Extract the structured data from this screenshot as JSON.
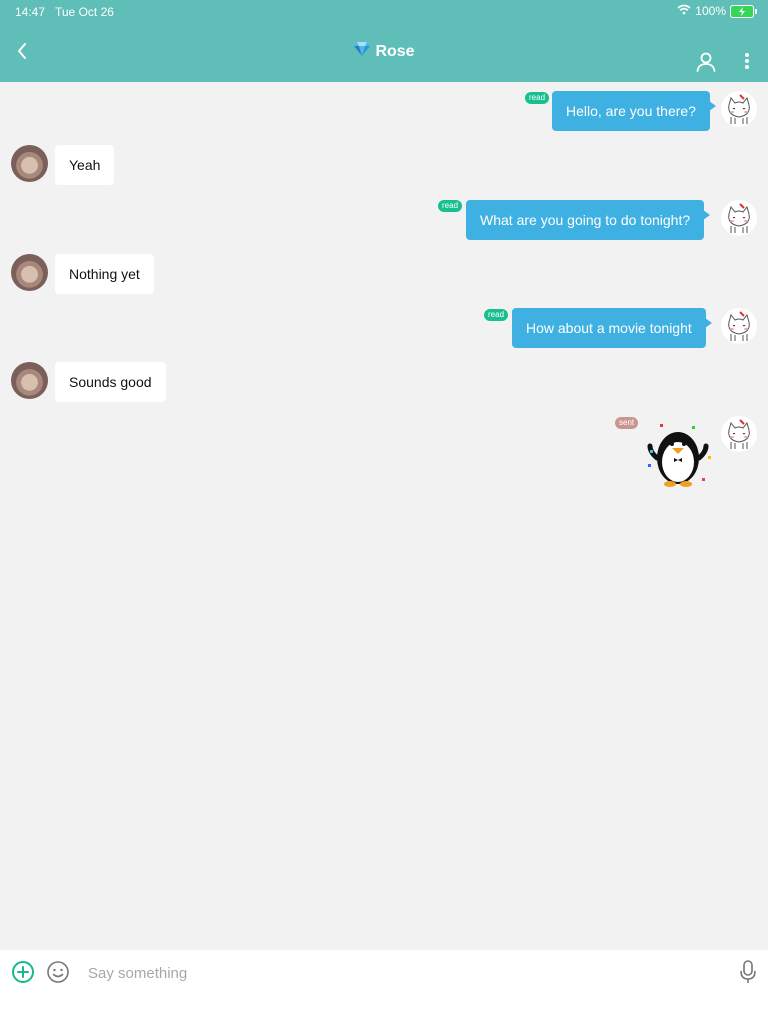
{
  "status_bar": {
    "time": "14:47",
    "date": "Tue Oct 26",
    "battery": "100%"
  },
  "header": {
    "title": "Rose",
    "title_icon": "diamond-icon",
    "back_icon": "chevron-left-icon",
    "profile_icon": "person-icon",
    "more_icon": "more-vertical-icon"
  },
  "messages": [
    {
      "side": "right",
      "text": "Hello, are you there?",
      "status": "read"
    },
    {
      "side": "left",
      "text": "Yeah"
    },
    {
      "side": "right",
      "text": "What are you going to do tonight?",
      "status": "read"
    },
    {
      "side": "left",
      "text": "Nothing yet"
    },
    {
      "side": "right",
      "text": "How about a movie tonight",
      "status": "read"
    },
    {
      "side": "left",
      "text": "Sounds good"
    },
    {
      "side": "right",
      "type": "sticker",
      "sticker": "penguin-sticker",
      "status": "sent"
    }
  ],
  "composer": {
    "placeholder": "Say something"
  },
  "colors": {
    "header": "#5fbfb8",
    "bubble_out": "#3eb1e2",
    "badge_read": "#18c08f",
    "badge_sent": "#c9968f"
  }
}
